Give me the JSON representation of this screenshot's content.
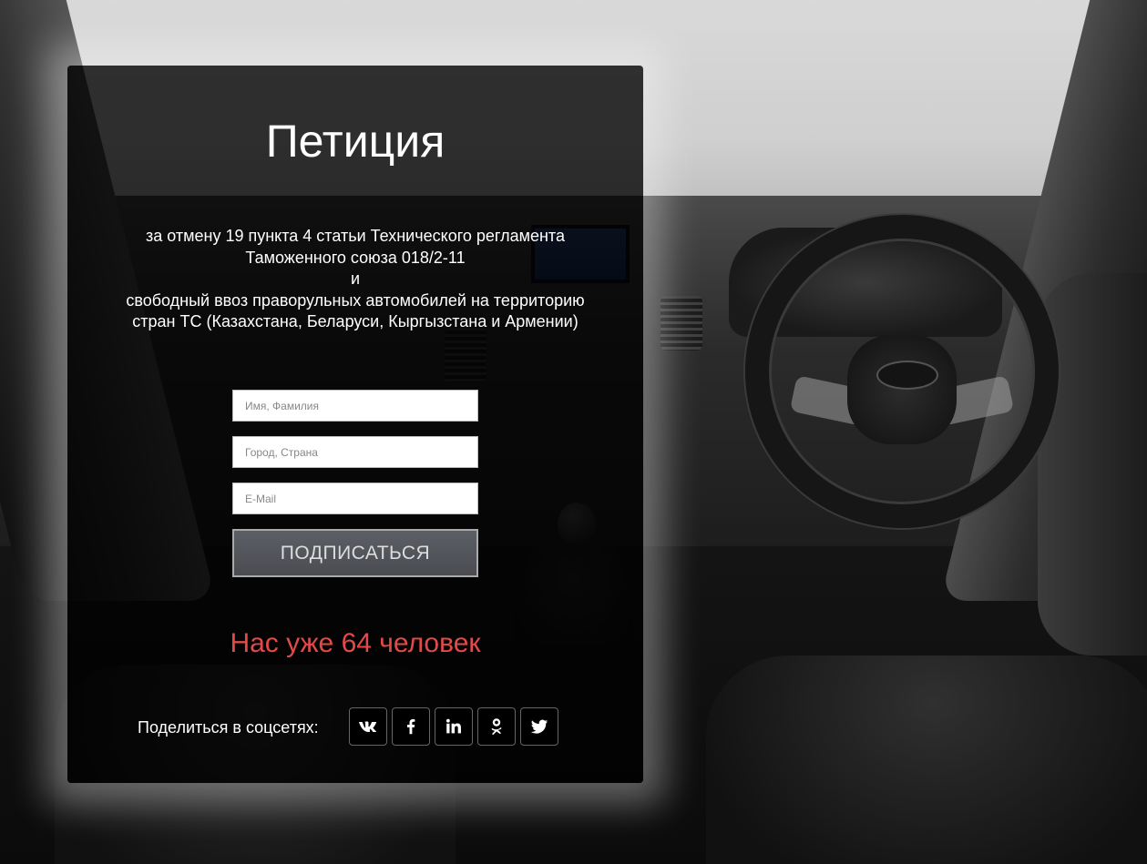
{
  "petition": {
    "title": "Петиция",
    "description_lines": [
      "за отмену 19 пункта 4 статьи Технического регламента",
      "Таможенного союза 018/2-11",
      "и",
      "свободный ввоз праворульных автомобилей на территорию",
      "стран ТС (Казахстана, Беларуси, Кыргызстана и Армении)"
    ]
  },
  "form": {
    "name_placeholder": "Имя, Фамилия",
    "city_placeholder": "Город, Страна",
    "email_placeholder": "E-Mail",
    "submit_label": "ПОДПИСАТЬСЯ"
  },
  "counter_text": "Нас уже 64 человек",
  "share": {
    "label": "Поделиться в соцсетях:",
    "networks": [
      "vk-icon",
      "facebook-icon",
      "linkedin-icon",
      "odnoklassniki-icon",
      "twitter-icon"
    ]
  },
  "colors": {
    "counter": "#e24a4a",
    "panel_bg": "rgba(0,0,0,0.78)",
    "button_bg": "#53555b"
  }
}
